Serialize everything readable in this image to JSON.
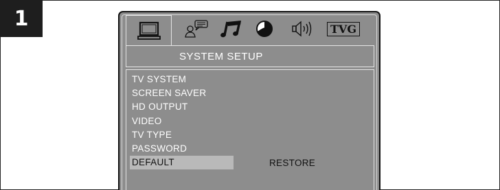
{
  "step": {
    "number": "1"
  },
  "osd": {
    "tabs": [
      {
        "name": "system",
        "icon": "monitor-icon",
        "active": true
      },
      {
        "name": "language",
        "icon": "language-speech-icon",
        "active": false
      },
      {
        "name": "audio",
        "icon": "music-note-icon",
        "active": false
      },
      {
        "name": "video",
        "icon": "video-contrast-icon",
        "active": false
      },
      {
        "name": "speaker",
        "icon": "speaker-icon",
        "active": false
      },
      {
        "name": "tvg",
        "label": "TVG",
        "active": false
      }
    ],
    "title": "SYSTEM SETUP",
    "menu": [
      {
        "label": "TV SYSTEM",
        "selected": false
      },
      {
        "label": "SCREEN SAVER",
        "selected": false
      },
      {
        "label": "HD OUTPUT",
        "selected": false
      },
      {
        "label": "VIDEO",
        "selected": false
      },
      {
        "label": "TV TYPE",
        "selected": false
      },
      {
        "label": "PASSWORD",
        "selected": false
      },
      {
        "label": "DEFAULT",
        "selected": true
      }
    ],
    "selected_option": "RESTORE",
    "colors": {
      "panel_bg": "#8d8d8d",
      "highlight": "#b9b9b9",
      "text": "#ffffff"
    }
  }
}
